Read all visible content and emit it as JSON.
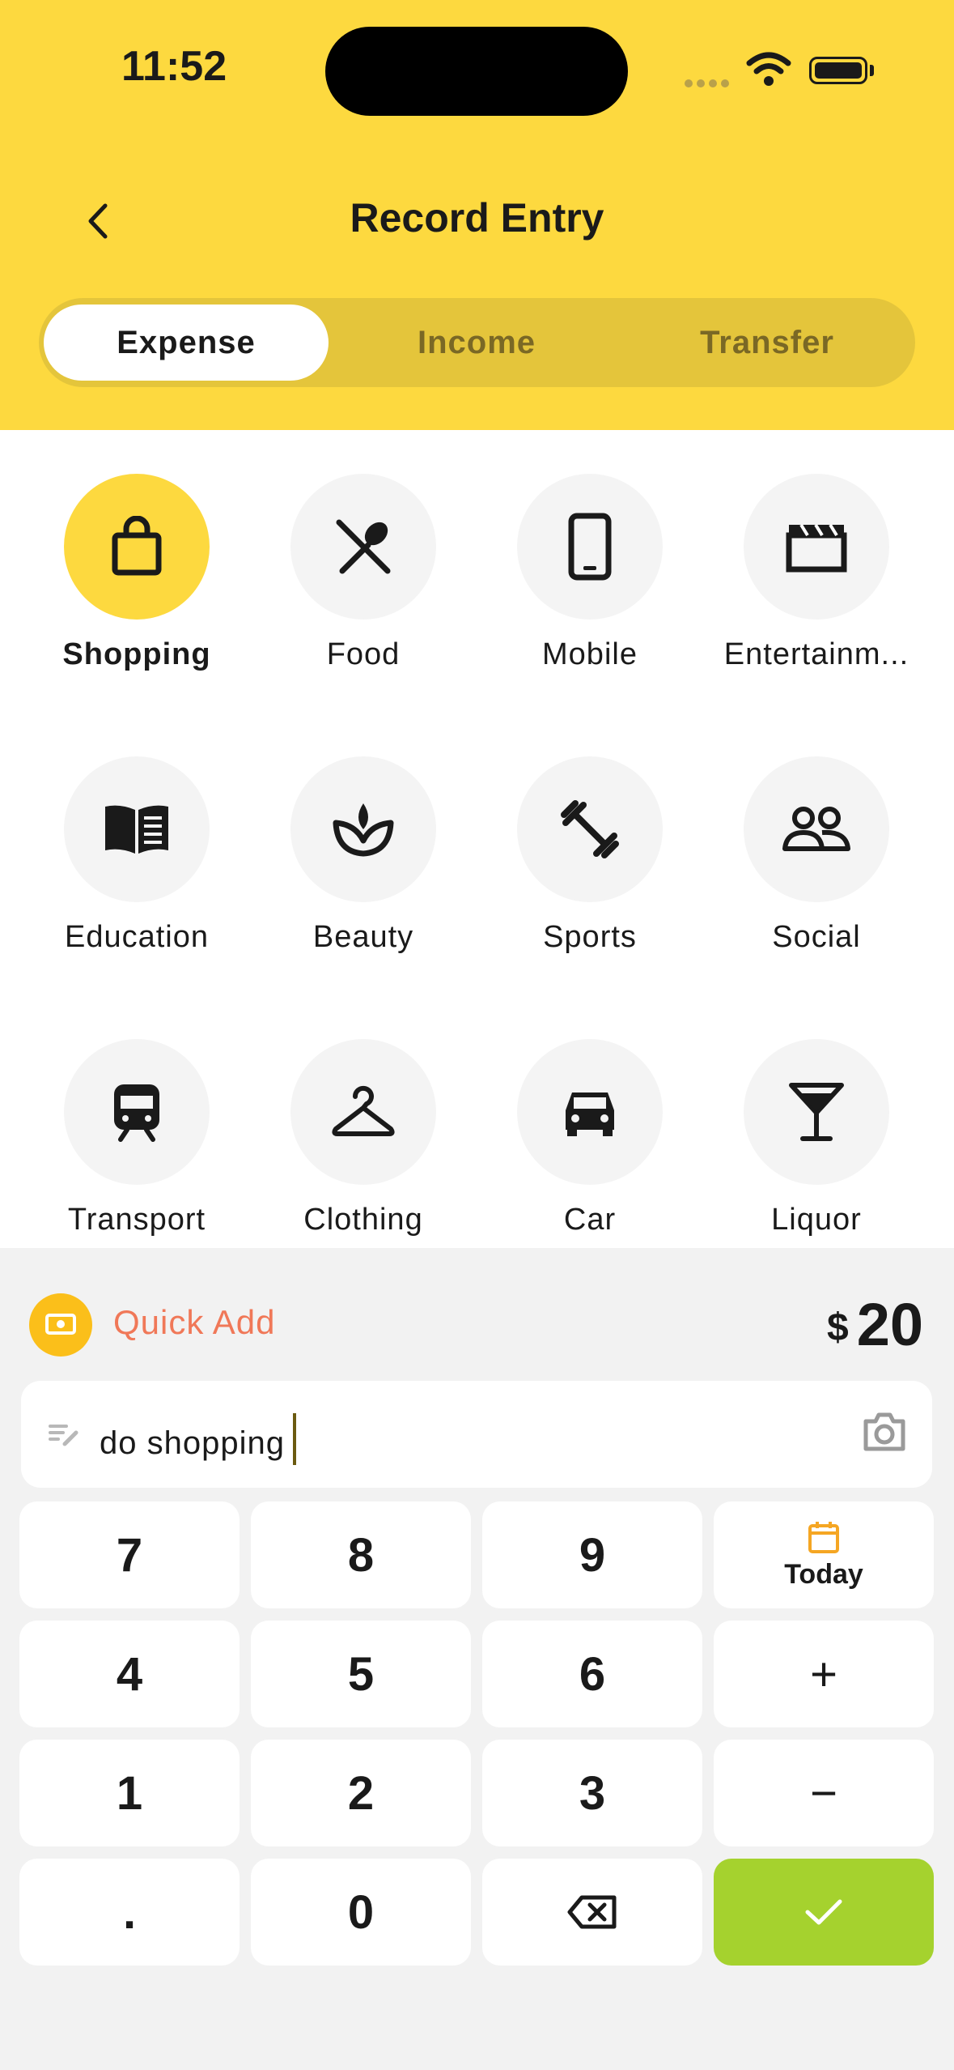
{
  "status_bar": {
    "time": "11:52"
  },
  "header": {
    "title": "Record Entry"
  },
  "tabs": [
    {
      "label": "Expense",
      "active": true
    },
    {
      "label": "Income",
      "active": false
    },
    {
      "label": "Transfer",
      "active": false
    }
  ],
  "categories": [
    {
      "label": "Shopping",
      "icon": "shopping-bag-icon",
      "selected": true
    },
    {
      "label": "Food",
      "icon": "fork-spoon-icon"
    },
    {
      "label": "Mobile",
      "icon": "phone-icon"
    },
    {
      "label": "Entertainm...",
      "icon": "clapperboard-icon"
    },
    {
      "label": "Education",
      "icon": "book-icon"
    },
    {
      "label": "Beauty",
      "icon": "lotus-icon"
    },
    {
      "label": "Sports",
      "icon": "dumbbell-icon"
    },
    {
      "label": "Social",
      "icon": "people-icon"
    },
    {
      "label": "Transport",
      "icon": "train-icon"
    },
    {
      "label": "Clothing",
      "icon": "hanger-icon"
    },
    {
      "label": "Car",
      "icon": "car-icon"
    },
    {
      "label": "Liquor",
      "icon": "cocktail-icon"
    }
  ],
  "quick_add": {
    "label": "Quick Add"
  },
  "amount": {
    "currency": "$",
    "value": "20"
  },
  "note": {
    "value": "do shopping"
  },
  "keypad": {
    "k7": "7",
    "k8": "8",
    "k9": "9",
    "today": "Today",
    "k4": "4",
    "k5": "5",
    "k6": "6",
    "plus": "+",
    "k1": "1",
    "k2": "2",
    "k3": "3",
    "minus": "−",
    "dot": ".",
    "k0": "0"
  },
  "colors": {
    "accent": "#fdd93f",
    "confirm": "#a5d22e",
    "quick_add": "#f07858",
    "calendar": "#f5a623"
  }
}
